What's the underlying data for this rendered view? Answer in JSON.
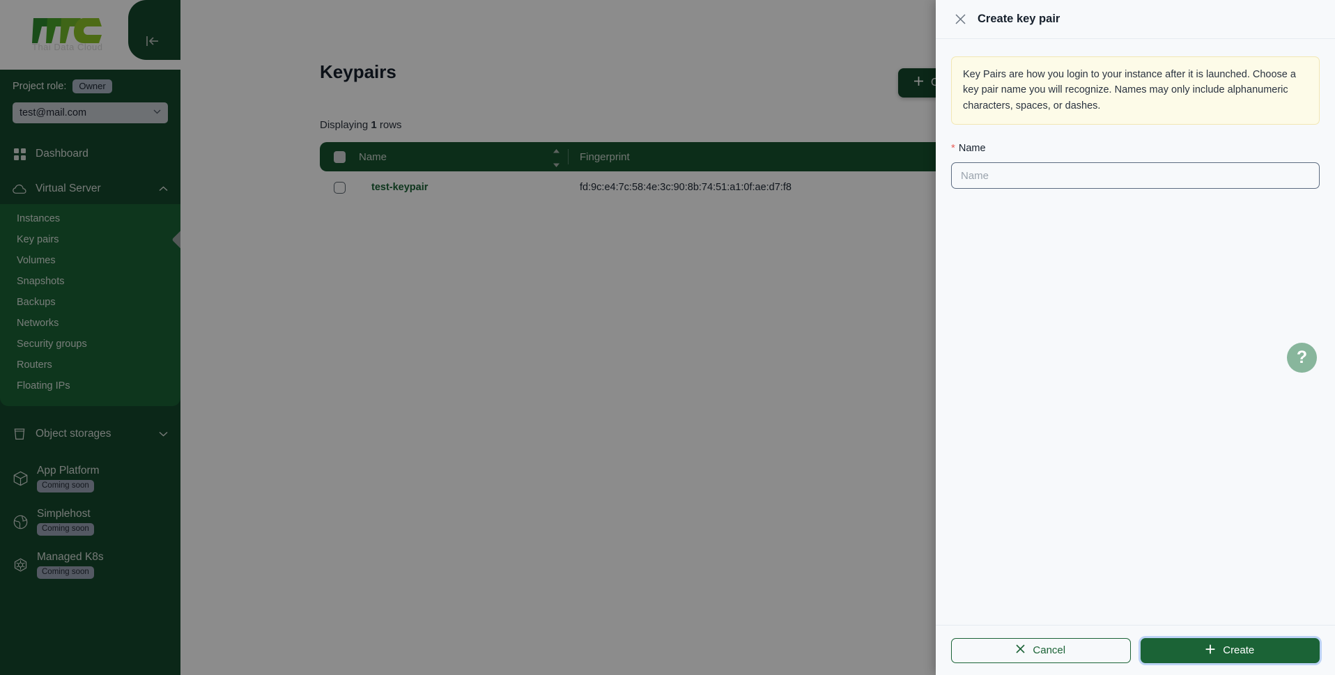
{
  "brand": {
    "logo_text": "TTC",
    "logo_subtext": "Thai Data Cloud"
  },
  "sidebar": {
    "collapse_icon": "collapse-left-icon",
    "project_role_label": "Project role:",
    "project_role_value": "Owner",
    "project_selected": "test@mail.com",
    "top_items": [
      {
        "label": "Dashboard",
        "icon": "grid-icon",
        "chevron": ""
      },
      {
        "label": "Virtual Server",
        "icon": "cloud-icon",
        "chevron": "chevron-up-icon"
      }
    ],
    "submenu": [
      {
        "label": "Instances",
        "active": false
      },
      {
        "label": "Key pairs",
        "active": true
      },
      {
        "label": "Volumes",
        "active": false
      },
      {
        "label": "Snapshots",
        "active": false
      },
      {
        "label": "Backups",
        "active": false
      },
      {
        "label": "Networks",
        "active": false
      },
      {
        "label": "Security groups",
        "active": false
      },
      {
        "label": "Routers",
        "active": false
      },
      {
        "label": "Floating IPs",
        "active": false
      }
    ],
    "object_storages": {
      "label": "Object storages",
      "icon": "bucket-icon",
      "chevron": "chevron-down-icon"
    },
    "coming_soon_items": [
      {
        "label": "App Platform",
        "badge": "Coming soon",
        "icon": "cube-icon"
      },
      {
        "label": "Simplehost",
        "badge": "Coming soon",
        "icon": "globe-icon"
      },
      {
        "label": "Managed K8s",
        "badge": "Coming soon",
        "icon": "kubernetes-icon"
      }
    ]
  },
  "main": {
    "page_title": "Keypairs",
    "displaying_prefix": "Displaying",
    "displaying_count": "1",
    "displaying_suffix": "rows",
    "create_button_label": "Create key pair",
    "table": {
      "columns": [
        "Name",
        "Fingerprint"
      ],
      "rows": [
        {
          "name": "test-keypair",
          "fingerprint": "fd:9c:e4:7c:58:4e:3c:90:8b:74:51:a1:0f:ae:d7:f8"
        }
      ]
    }
  },
  "drawer": {
    "title": "Create key pair",
    "close_icon": "close-icon",
    "info_text": "Key Pairs are how you login to your instance after it is launched. Choose a key pair name you will recognize. Names may only include alphanumeric characters, spaces, or dashes.",
    "name_label": "Name",
    "name_required_marker": "*",
    "name_value": "",
    "name_placeholder": "Name",
    "cancel_label": "Cancel",
    "create_label": "Create"
  },
  "help": {
    "label": "?"
  },
  "colors": {
    "sidebar_bg": "#14472c",
    "submenu_bg": "#1b6336",
    "accent_green": "#1b6336",
    "table_header": "#17532f",
    "info_bg": "#fdfbe8",
    "drawer_bg": "#f7f9fb",
    "required_red": "#e8615a"
  }
}
